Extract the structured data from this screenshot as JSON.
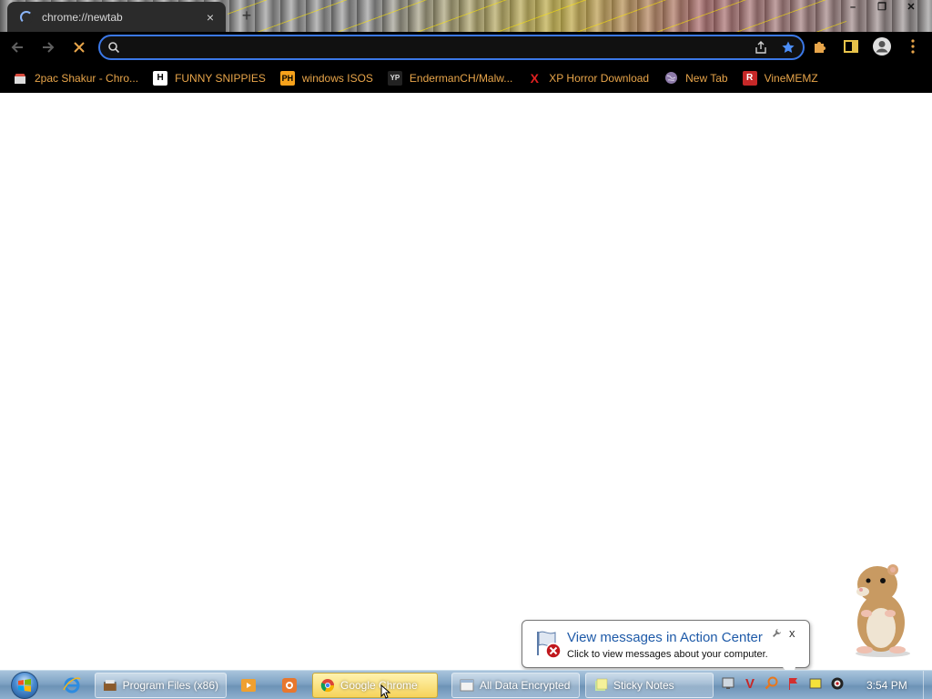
{
  "browser": {
    "tab": {
      "title": "chrome://newtab",
      "close_icon": "×"
    },
    "new_tab_icon": "+",
    "window_controls": {
      "minimize": "–",
      "restore": "❐",
      "close": "✕"
    },
    "omnibox": {
      "value": "",
      "placeholder": ""
    },
    "colors": {
      "accent": "#3b78e7",
      "bookmark_text": "#e8a54a",
      "toolbar_bg": "#000000"
    }
  },
  "bookmarks": [
    {
      "label": "2pac Shakur - Chro...",
      "icon": "shop-icon"
    },
    {
      "label": "FUNNY SNIPPIES",
      "icon": "h-icon",
      "glyph": "H"
    },
    {
      "label": "windows ISOS",
      "icon": "ph-icon",
      "glyph": "PH"
    },
    {
      "label": "EndermanCH/Malw...",
      "icon": "yp-icon",
      "glyph": "YP"
    },
    {
      "label": "XP Horror Download",
      "icon": "x-icon",
      "glyph": "X"
    },
    {
      "label": "New Tab",
      "icon": "globe-icon"
    },
    {
      "label": "VineMEMZ",
      "icon": "r-icon",
      "glyph": "R"
    }
  ],
  "balloon": {
    "title": "View messages in Action Center",
    "text": "Click to view messages about your computer.",
    "close": "x"
  },
  "taskbar": {
    "items": [
      {
        "label": "Program Files (x86)"
      },
      {
        "label": "Google Chrome"
      },
      {
        "label": "All Data Encrypted"
      },
      {
        "label": "Sticky Notes"
      }
    ],
    "clock": "3:54 PM"
  }
}
